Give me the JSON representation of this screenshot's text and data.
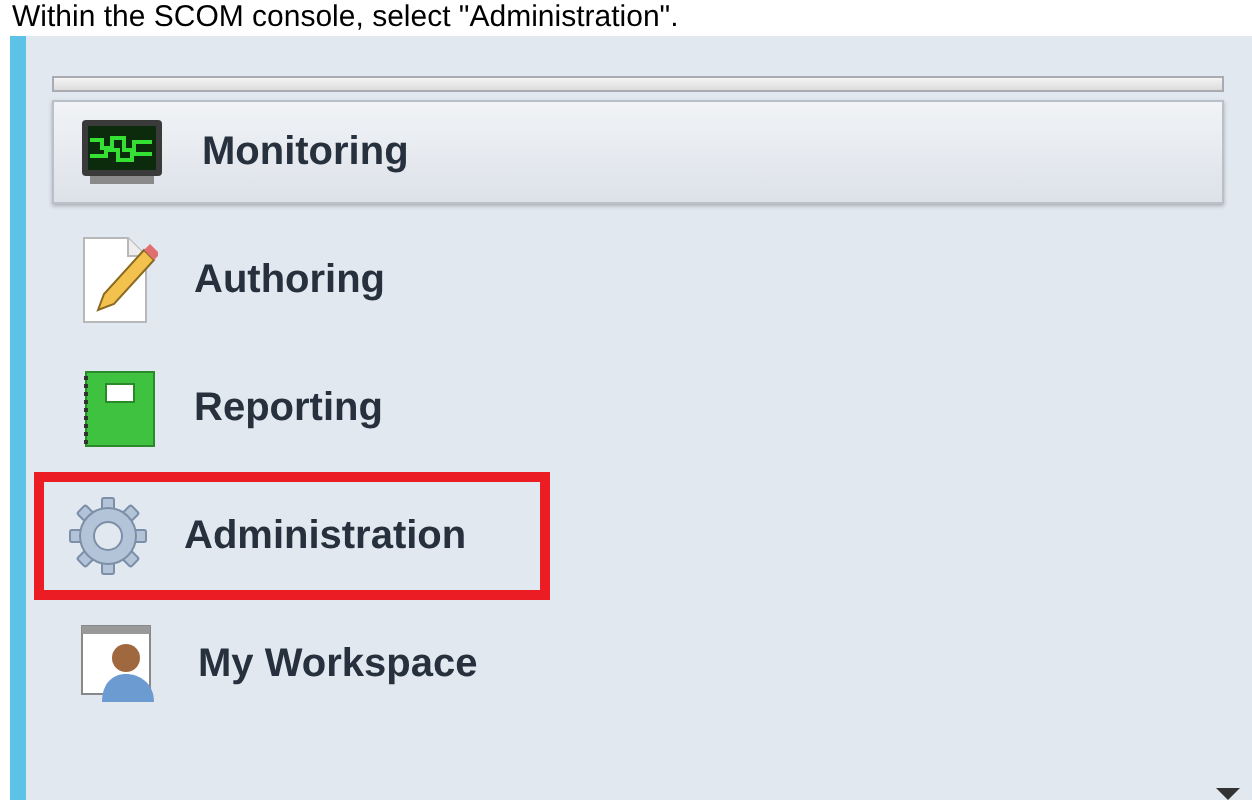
{
  "caption": "Within the SCOM console, select \"Administration\".",
  "navigation": {
    "items": [
      {
        "label": "Monitoring",
        "kind": "monitoring",
        "selected": true,
        "highlighted": false
      },
      {
        "label": "Authoring",
        "kind": "authoring",
        "selected": false,
        "highlighted": false
      },
      {
        "label": "Reporting",
        "kind": "reporting",
        "selected": false,
        "highlighted": false
      },
      {
        "label": "Administration",
        "kind": "administration",
        "selected": false,
        "highlighted": true
      },
      {
        "label": "My Workspace",
        "kind": "workspace",
        "selected": false,
        "highlighted": false
      }
    ]
  }
}
